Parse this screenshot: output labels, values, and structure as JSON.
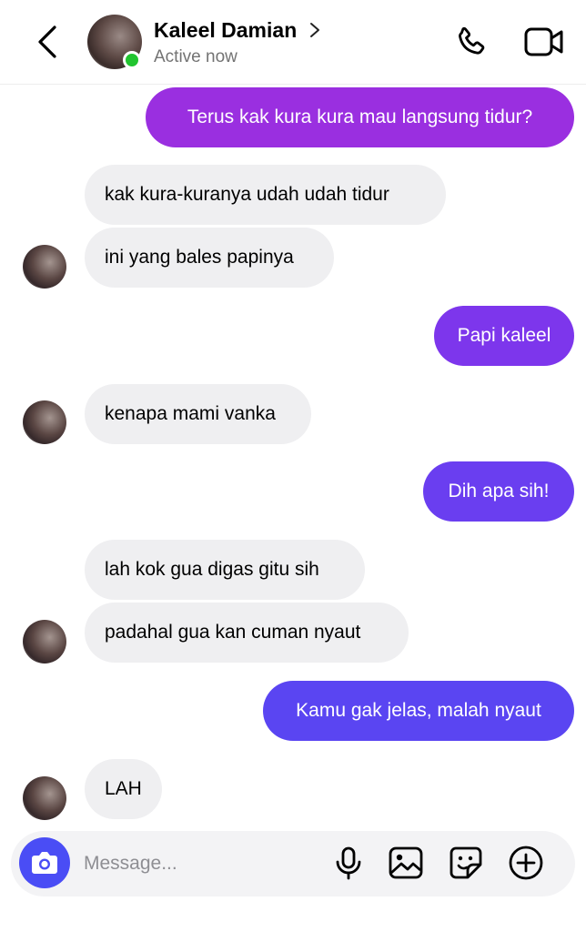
{
  "header": {
    "contact_name": "Kaleel Damian",
    "status": "Active now",
    "icons": {
      "back": "chevron-left-icon",
      "profile": "chevron-right-icon",
      "call": "phone-icon",
      "video": "video-camera-icon"
    },
    "online_color": "#21c42f"
  },
  "messages": [
    {
      "side": "out",
      "text": "Terus kak kura kura mau langsung tidur?",
      "color": "#9a2fe0"
    },
    {
      "side": "in",
      "text": "kak kura-kuranya udah udah tidur"
    },
    {
      "side": "in",
      "text": "ini yang bales papinya"
    },
    {
      "side": "out",
      "text": "Papi kaleel",
      "color": "#7d36ec"
    },
    {
      "side": "in",
      "text": "kenapa mami vanka"
    },
    {
      "side": "out",
      "text": "Dih apa sih!",
      "color": "#6a3ef0"
    },
    {
      "side": "in",
      "text": "lah kok gua digas gitu sih"
    },
    {
      "side": "in",
      "text": "padahal gua kan cuman nyaut"
    },
    {
      "side": "out",
      "text": "Kamu gak jelas, malah nyaut",
      "color": "#5a45f2"
    },
    {
      "side": "in",
      "text": "LAH"
    }
  ],
  "composer": {
    "placeholder": "Message...",
    "camera_icon": "camera-icon",
    "camera_color": "#4a4df5",
    "tools": [
      "microphone-icon",
      "image-icon",
      "sticker-icon",
      "plus-circle-icon"
    ]
  }
}
